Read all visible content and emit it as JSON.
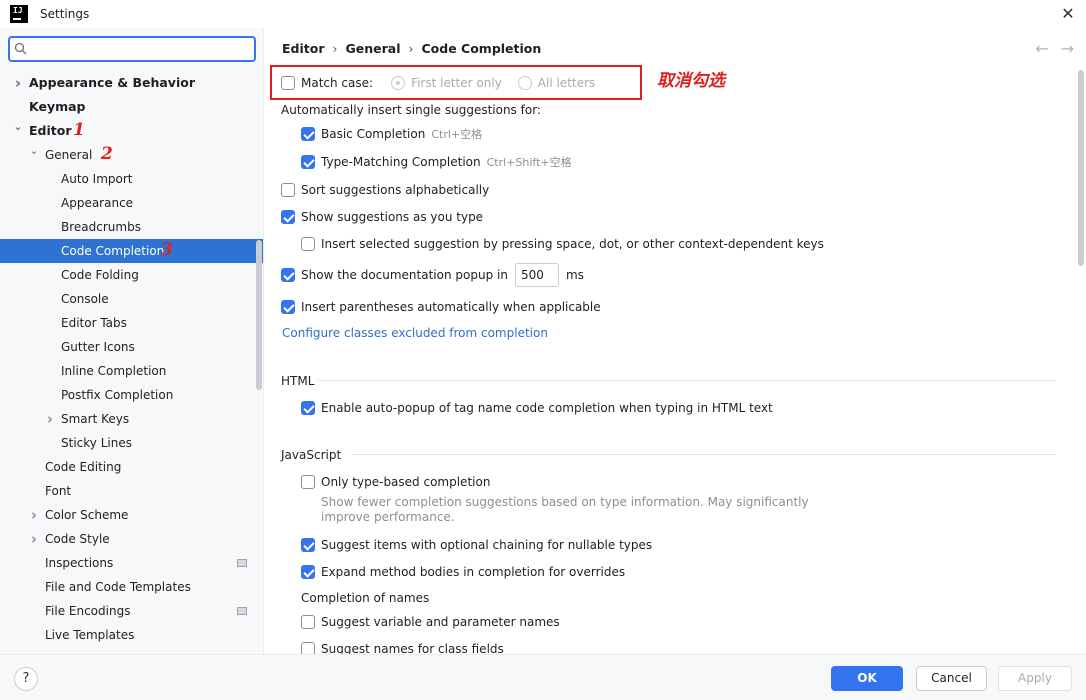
{
  "window": {
    "title": "Settings",
    "app_icon_text": "IJ"
  },
  "search": {
    "placeholder": "",
    "value": ""
  },
  "sidebar": {
    "items": [
      {
        "label": "Appearance & Behavior",
        "level": 0,
        "bold": true,
        "chevron": "right"
      },
      {
        "label": "Keymap",
        "level": 0,
        "bold": true,
        "chevron": ""
      },
      {
        "label": "Editor",
        "level": 0,
        "bold": true,
        "chevron": "down",
        "annotation": "1"
      },
      {
        "label": "General",
        "level": 1,
        "bold": false,
        "chevron": "down",
        "annotation": "2"
      },
      {
        "label": "Auto Import",
        "level": 2
      },
      {
        "label": "Appearance",
        "level": 2
      },
      {
        "label": "Breadcrumbs",
        "level": 2
      },
      {
        "label": "Code Completion",
        "level": 2,
        "selected": true,
        "annotation": "3"
      },
      {
        "label": "Code Folding",
        "level": 2
      },
      {
        "label": "Console",
        "level": 2
      },
      {
        "label": "Editor Tabs",
        "level": 2
      },
      {
        "label": "Gutter Icons",
        "level": 2
      },
      {
        "label": "Inline Completion",
        "level": 2
      },
      {
        "label": "Postfix Completion",
        "level": 2
      },
      {
        "label": "Smart Keys",
        "level": 2,
        "chevron": "right"
      },
      {
        "label": "Sticky Lines",
        "level": 2
      },
      {
        "label": "Code Editing",
        "level": 1
      },
      {
        "label": "Font",
        "level": 1
      },
      {
        "label": "Color Scheme",
        "level": 1,
        "chevron": "right"
      },
      {
        "label": "Code Style",
        "level": 1,
        "chevron": "right"
      },
      {
        "label": "Inspections",
        "level": 1,
        "badge": true
      },
      {
        "label": "File and Code Templates",
        "level": 1
      },
      {
        "label": "File Encodings",
        "level": 1,
        "badge": true
      },
      {
        "label": "Live Templates",
        "level": 1
      }
    ]
  },
  "breadcrumb": [
    "Editor",
    "General",
    "Code Completion"
  ],
  "main": {
    "match_case": {
      "label": "Match case:",
      "checked": false
    },
    "radio_first": {
      "label": "First letter only",
      "selected": true,
      "disabled": true
    },
    "radio_all": {
      "label": "All letters",
      "selected": false,
      "disabled": true
    },
    "annotation": "取消勾选",
    "auto_insert_label": "Automatically insert single suggestions for:",
    "basic_completion": {
      "label": "Basic Completion",
      "shortcut": "Ctrl+空格",
      "checked": true
    },
    "type_matching": {
      "label": "Type-Matching Completion",
      "shortcut": "Ctrl+Shift+空格",
      "checked": true
    },
    "sort_alpha": {
      "label": "Sort suggestions alphabetically",
      "checked": false
    },
    "show_as_type": {
      "label": "Show suggestions as you type",
      "checked": true
    },
    "insert_selected": {
      "label": "Insert selected suggestion by pressing space, dot, or other context-dependent keys",
      "checked": false
    },
    "doc_popup": {
      "label": "Show the documentation popup in",
      "value": "500",
      "unit": "ms",
      "checked": true
    },
    "insert_parens": {
      "label": "Insert parentheses automatically when applicable",
      "checked": true
    },
    "configure_link": "Configure classes excluded from completion",
    "html_section": "HTML",
    "html_autopopup": {
      "label": "Enable auto-popup of tag name code completion when typing in HTML text",
      "checked": true
    },
    "js_section": "JavaScript",
    "only_type_based": {
      "label": "Only type-based completion",
      "checked": false
    },
    "only_type_based_desc_1": "Show fewer completion suggestions based on type information. May significantly",
    "only_type_based_desc_2": "improve performance.",
    "optional_chaining": {
      "label": "Suggest items with optional chaining for nullable types",
      "checked": true
    },
    "expand_bodies": {
      "label": "Expand method bodies in completion for overrides",
      "checked": true
    },
    "completion_of_names": "Completion of names",
    "suggest_var_names": {
      "label": "Suggest variable and parameter names",
      "checked": false
    },
    "suggest_class_fields": {
      "label": "Suggest names for class fields",
      "checked": false
    }
  },
  "footer": {
    "help": "?",
    "ok": "OK",
    "cancel": "Cancel",
    "apply": "Apply"
  },
  "colors": {
    "accent": "#3574f0",
    "selection": "#2f73d2",
    "annotation_red": "#e02020",
    "link": "#2f6fcf"
  }
}
